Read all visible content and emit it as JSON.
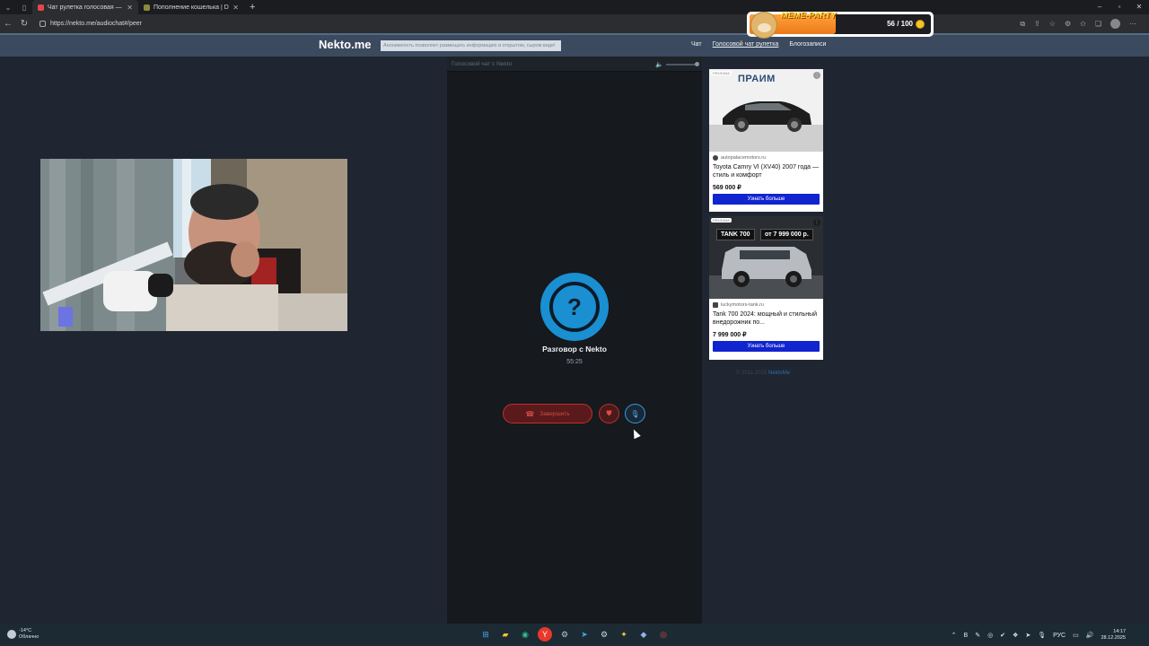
{
  "browser": {
    "tabs": [
      {
        "title": "Чат рулетка голосовая — N",
        "active": true,
        "favicon_color": "#e34848"
      },
      {
        "title": "Пополнение кошелька | Dragon",
        "active": false,
        "favicon_color": "#8a8a3a"
      }
    ],
    "url": "https://nekto.me/audiochat#/peer"
  },
  "site": {
    "logo": "Nekto.me",
    "notice": "Анонимность позволяет размещать информацию в открытом, сыром виде!",
    "nav": [
      "Чат",
      "Голосовой чат рулетка",
      "Блогозаписи"
    ]
  },
  "chat": {
    "header": "Голосовой чат с Nekto",
    "peer_symbol": "?",
    "peer_name": "Разговор с Nekto",
    "timer": "55:25",
    "end_button": "Завершить"
  },
  "ads": [
    {
      "badge": "РЕКЛАМА",
      "brand": "ПРАИМ",
      "domain": "autopalacemotors.ru",
      "title": "Toyota Camry VI (XV40) 2007 года — стиль и комфорт",
      "price": "569 000 ₽",
      "button": "Узнать больше"
    },
    {
      "badge": "РЕКЛАМА",
      "brand": "TANK 700",
      "promo": "от 7 999 000 р.",
      "domain": "luckymotors-tank.ru",
      "title": "Tank 700 2024: мощный и стильный внедорожник по...",
      "price": "7 999 000 ₽",
      "button": "Узнать больше"
    }
  ],
  "footer": {
    "copyright": "© 2011-2025",
    "link": "NektoMe"
  },
  "meme_party": {
    "title": "MEME-PARTY",
    "count": "56 / 100",
    "progress": 0.56
  },
  "taskbar": {
    "weather_temp": "-14°C",
    "weather_desc": "Облачно",
    "lang": "РУС",
    "time": "14:17",
    "date": "28.12.2025"
  },
  "colors": {
    "accent": "#1a8fd1",
    "danger": "#c0302c",
    "ad_button": "#1024d0"
  }
}
